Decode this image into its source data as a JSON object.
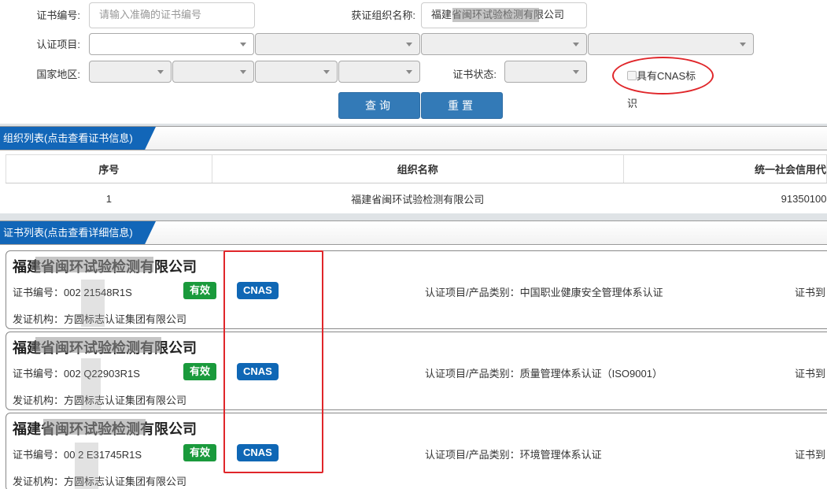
{
  "search": {
    "cert_no_label": "证书编号:",
    "cert_no_placeholder": "请输入准确的证书编号",
    "org_name_label": "获证组织名称:",
    "org_name_value": "福建省闽环试验检测有限公司",
    "project_label": "认证项目:",
    "region_label": "国家地区:",
    "status_label": "证书状态:",
    "cnas_checkbox_label_line1": "具有CNAS标",
    "cnas_checkbox_label_line2": "识",
    "cnas_checked": false,
    "query_button": "查询",
    "reset_button": "重置"
  },
  "org_section": {
    "title": "组织列表(点击查看证书信息)",
    "columns": [
      "序号",
      "组织名称",
      "统一社会信用代"
    ],
    "rows": [
      {
        "index": "1",
        "name": "福建省闽环试验检测有限公司",
        "credit_code": "91350100"
      }
    ]
  },
  "cert_section": {
    "title": "证书列表(点击查看详细信息)",
    "cert_no_prefix": "证书编号：",
    "issuer_prefix": "发证机构：",
    "project_prefix": "认证项目/产品类别：",
    "expire_prefix": "证书到",
    "items": [
      {
        "org_name": "福建省闽环试验检测有限公司",
        "cert_no": "002  21548R1S",
        "status": "有效",
        "badge": "CNAS",
        "issuer": "方圆标志认证集团有限公司",
        "project": "中国职业健康安全管理体系认证"
      },
      {
        "org_name": "福建省闽环试验检测有限公司",
        "cert_no": "002  Q22903R1S",
        "status": "有效",
        "badge": "CNAS",
        "issuer": "方圆标志认证集团有限公司",
        "project": "质量管理体系认证（ISO9001）"
      },
      {
        "org_name": "福建省闽环试验检测有限公司",
        "cert_no": "00 2 E31745R1S",
        "status": "有效",
        "badge": "CNAS",
        "issuer": "方圆标志认证集团有限公司",
        "project": "环境管理体系认证"
      }
    ]
  },
  "colors": {
    "primary": "#337ab7",
    "section_title": "#1266b8",
    "status_valid": "#1a9a3c",
    "cnas_badge": "#0f67b5",
    "annotation_red": "#e0262a"
  }
}
